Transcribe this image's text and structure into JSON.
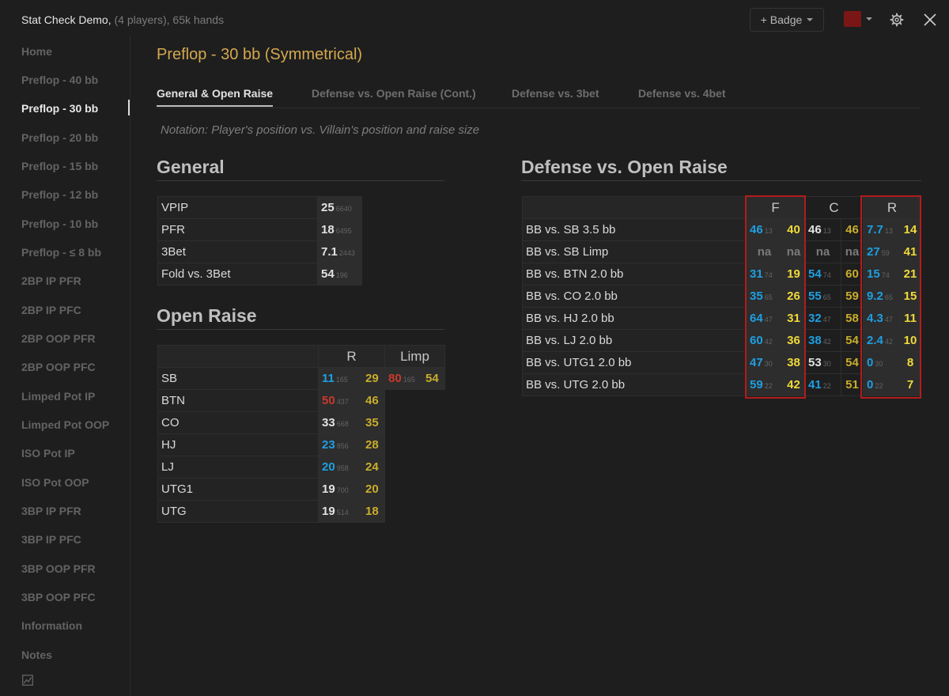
{
  "header": {
    "title": "Stat Check Demo,",
    "subtitle": "(4 players), 65k hands",
    "badge_label": "+ Badge",
    "accent_color": "#7a1616"
  },
  "sidebar": {
    "items": [
      {
        "label": "Home"
      },
      {
        "label": "Preflop - 40 bb"
      },
      {
        "label": "Preflop - 30 bb",
        "active": true
      },
      {
        "label": "Preflop - 20 bb"
      },
      {
        "label": "Preflop - 15 bb"
      },
      {
        "label": "Preflop - 12 bb"
      },
      {
        "label": "Preflop - 10 bb"
      },
      {
        "label": "Preflop - ≤ 8 bb"
      },
      {
        "label": "2BP IP PFR"
      },
      {
        "label": "2BP IP PFC"
      },
      {
        "label": "2BP OOP PFR"
      },
      {
        "label": "2BP OOP PFC"
      },
      {
        "label": "Limped Pot IP"
      },
      {
        "label": "Limped Pot OOP"
      },
      {
        "label": "ISO Pot IP"
      },
      {
        "label": "ISO Pot OOP"
      },
      {
        "label": "3BP IP PFR"
      },
      {
        "label": "3BP IP PFC"
      },
      {
        "label": "3BP OOP PFR"
      },
      {
        "label": "3BP OOP PFC"
      },
      {
        "label": "Information"
      },
      {
        "label": "Notes"
      }
    ]
  },
  "main": {
    "title": "Preflop - 30 bb (Symmetrical)",
    "tabs": [
      {
        "label": "General & Open Raise",
        "active": true
      },
      {
        "label": "Defense vs. Open Raise (Cont.)"
      },
      {
        "label": "Defense vs. 3bet"
      },
      {
        "label": "Defense vs. 4bet"
      }
    ],
    "notation": "Notation: Player's position vs. Villain's position and raise size"
  },
  "general": {
    "title": "General",
    "rows": [
      {
        "label": "VPIP",
        "value": "25",
        "n": "6640"
      },
      {
        "label": "PFR",
        "value": "18",
        "n": "6495"
      },
      {
        "label": "3Bet",
        "value": "7.1",
        "n": "2443"
      },
      {
        "label": "Fold vs. 3Bet",
        "value": "54",
        "n": "196"
      }
    ]
  },
  "open_raise": {
    "title": "Open Raise",
    "headers": {
      "r": "R",
      "limp": "Limp"
    },
    "rows": [
      {
        "label": "SB",
        "r_value": "11",
        "r_color": "blue",
        "r_n": "165",
        "r_target": "29",
        "r_target_color": "olive",
        "limp_value": "80",
        "limp_color": "red",
        "limp_n": "165",
        "limp_target": "54",
        "limp_target_color": "olive"
      },
      {
        "label": "BTN",
        "r_value": "50",
        "r_color": "red",
        "r_n": "437",
        "r_target": "46",
        "r_target_color": "olive"
      },
      {
        "label": "CO",
        "r_value": "33",
        "r_color": "white",
        "r_n": "668",
        "r_target": "35",
        "r_target_color": "olive"
      },
      {
        "label": "HJ",
        "r_value": "23",
        "r_color": "blue",
        "r_n": "856",
        "r_target": "28",
        "r_target_color": "olive"
      },
      {
        "label": "LJ",
        "r_value": "20",
        "r_color": "blue",
        "r_n": "958",
        "r_target": "24",
        "r_target_color": "olive"
      },
      {
        "label": "UTG1",
        "r_value": "19",
        "r_color": "white",
        "r_n": "700",
        "r_target": "20",
        "r_target_color": "olive"
      },
      {
        "label": "UTG",
        "r_value": "19",
        "r_color": "white",
        "r_n": "514",
        "r_target": "18",
        "r_target_color": "olive"
      }
    ]
  },
  "defense": {
    "title": "Defense vs. Open Raise",
    "headers": {
      "f": "F",
      "c": "C",
      "r": "R"
    },
    "rows": [
      {
        "label": "BB vs. SB 3.5 bb",
        "f": {
          "v": "46",
          "c": "blue",
          "n": "13",
          "t": "40"
        },
        "c": {
          "v": "46",
          "c": "white",
          "n": "13",
          "t": "46"
        },
        "r": {
          "v": "7.7",
          "c": "blue",
          "n": "13",
          "t": "14"
        }
      },
      {
        "label": "BB vs. SB Limp",
        "f": {
          "v": "na",
          "c": "na",
          "n": "",
          "t": "na",
          "tc": "na"
        },
        "c": {
          "v": "na",
          "c": "na",
          "n": "",
          "t": "na",
          "tc": "na"
        },
        "r": {
          "v": "27",
          "c": "blue",
          "n": "59",
          "t": "41"
        }
      },
      {
        "label": "BB vs. BTN 2.0 bb",
        "f": {
          "v": "31",
          "c": "blue",
          "n": "74",
          "t": "19"
        },
        "c": {
          "v": "54",
          "c": "blue",
          "n": "74",
          "t": "60"
        },
        "r": {
          "v": "15",
          "c": "blue",
          "n": "74",
          "t": "21"
        }
      },
      {
        "label": "BB vs. CO 2.0 bb",
        "f": {
          "v": "35",
          "c": "blue",
          "n": "65",
          "t": "26"
        },
        "c": {
          "v": "55",
          "c": "blue",
          "n": "65",
          "t": "59"
        },
        "r": {
          "v": "9.2",
          "c": "blue",
          "n": "65",
          "t": "15"
        }
      },
      {
        "label": "BB vs. HJ 2.0 bb",
        "f": {
          "v": "64",
          "c": "blue",
          "n": "47",
          "t": "31"
        },
        "c": {
          "v": "32",
          "c": "blue",
          "n": "47",
          "t": "58"
        },
        "r": {
          "v": "4.3",
          "c": "blue",
          "n": "47",
          "t": "11"
        }
      },
      {
        "label": "BB vs. LJ 2.0 bb",
        "f": {
          "v": "60",
          "c": "blue",
          "n": "42",
          "t": "36"
        },
        "c": {
          "v": "38",
          "c": "blue",
          "n": "42",
          "t": "54"
        },
        "r": {
          "v": "2.4",
          "c": "blue",
          "n": "42",
          "t": "10"
        }
      },
      {
        "label": "BB vs. UTG1 2.0 bb",
        "f": {
          "v": "47",
          "c": "blue",
          "n": "30",
          "t": "38"
        },
        "c": {
          "v": "53",
          "c": "white",
          "n": "30",
          "t": "54"
        },
        "r": {
          "v": "0",
          "c": "blue",
          "n": "30",
          "t": "8"
        }
      },
      {
        "label": "BB vs. UTG 2.0 bb",
        "f": {
          "v": "59",
          "c": "blue",
          "n": "22",
          "t": "42"
        },
        "c": {
          "v": "41",
          "c": "blue",
          "n": "22",
          "t": "51"
        },
        "r": {
          "v": "0",
          "c": "blue",
          "n": "22",
          "t": "7"
        }
      }
    ]
  },
  "colors": {
    "accent_title": "#d4a84f",
    "highlight_border": "#b31b1b",
    "blue": "#1e9fe2",
    "yellow": "#f0da3a",
    "red": "#c8392c"
  }
}
